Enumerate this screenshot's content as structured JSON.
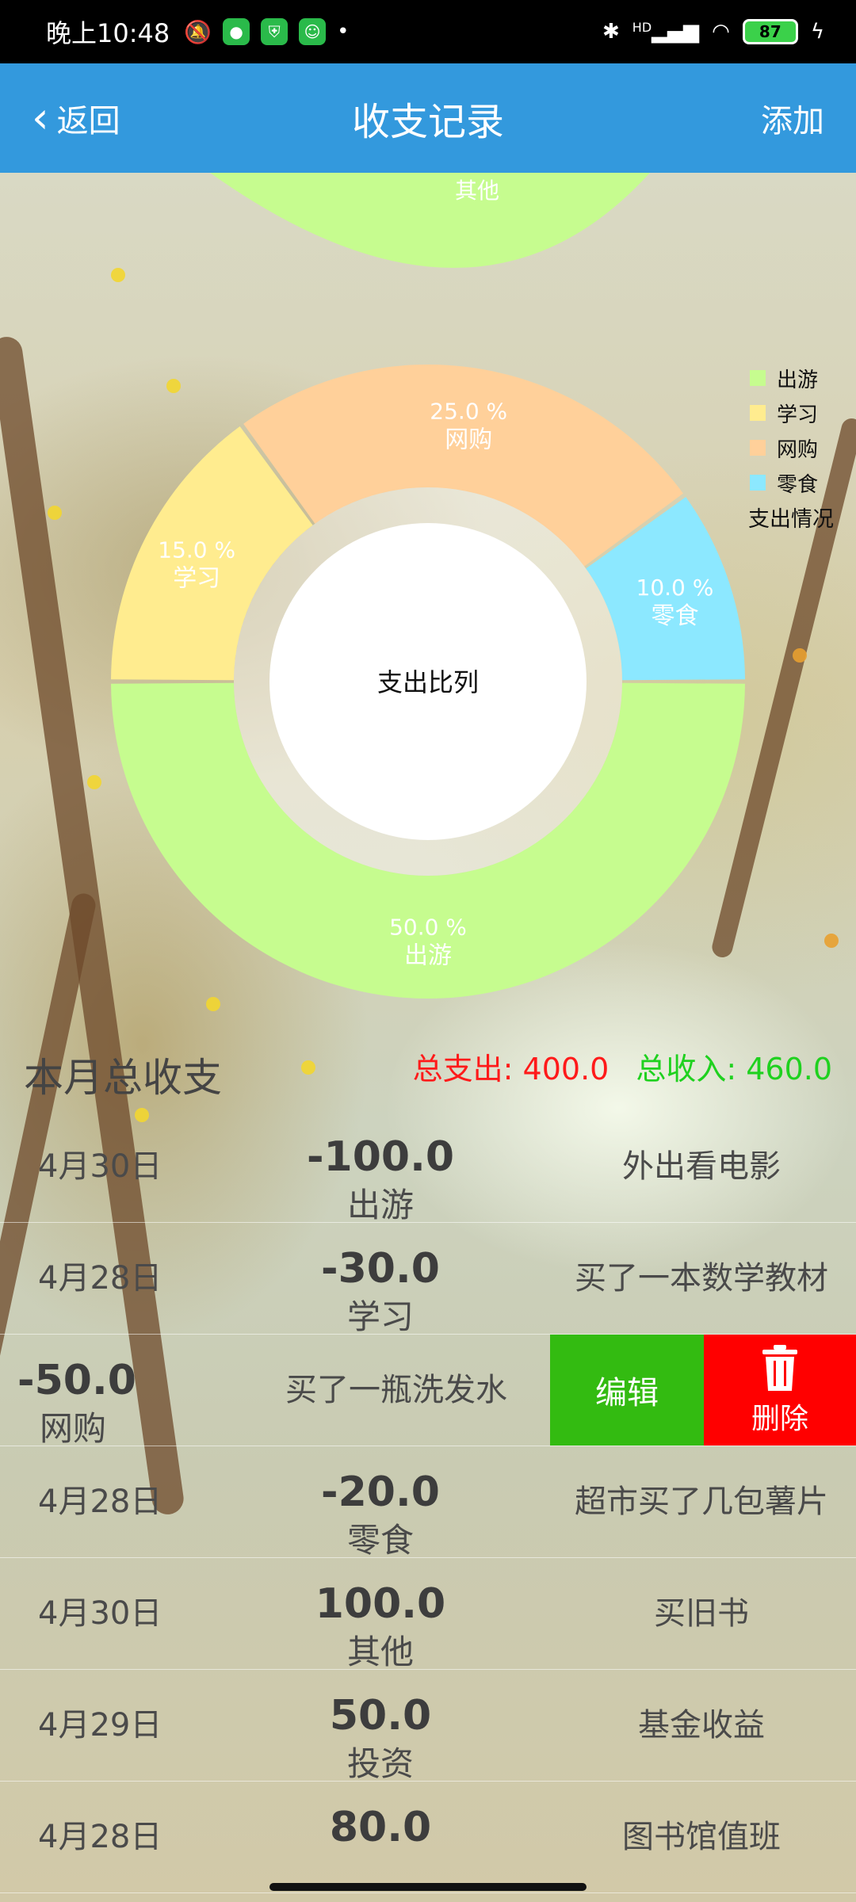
{
  "status_bar": {
    "time": "晚上10:48",
    "battery": "87",
    "network": "HD",
    "dot": "•"
  },
  "header": {
    "back_label": "返回",
    "back_icon": "chevron-left-icon",
    "title": "收支记录",
    "add_label": "添加"
  },
  "colors": {
    "header_bg": "#3399dd",
    "expense": "#ff1a1a",
    "income": "#1fd11f",
    "edit_button": "#33bb11",
    "delete_button": "#ff0000"
  },
  "chart_data": [
    {
      "type": "pie",
      "partial": true,
      "slices": [
        {
          "label": "其他",
          "color": "#c6fc8f"
        }
      ]
    },
    {
      "type": "pie",
      "style": "donut",
      "center_text": "支出比列",
      "legend_title": "支出情况",
      "legend_position": "right",
      "slices": [
        {
          "label": "出游",
          "value": 50.0,
          "value_label": "50.0 %",
          "color": "#c6fc8f"
        },
        {
          "label": "学习",
          "value": 15.0,
          "value_label": "15.0 %",
          "color": "#ffec8f"
        },
        {
          "label": "网购",
          "value": 25.0,
          "value_label": "25.0 %",
          "color": "#ffd09a"
        },
        {
          "label": "零食",
          "value": 10.0,
          "value_label": "10.0 %",
          "color": "#8ce8ff"
        }
      ]
    }
  ],
  "summary": {
    "title": "本月总收支",
    "expense_text": "总支出: 400.0",
    "income_text": "总收入: 460.0"
  },
  "swipe_actions": {
    "edit_label": "编辑",
    "delete_label": "删除"
  },
  "records": [
    {
      "date": "4月30日",
      "amount": "-100.0",
      "category": "出游",
      "note": "外出看电影"
    },
    {
      "date": "4月28日",
      "amount": "-30.0",
      "category": "学习",
      "note": "买了一本数学教材"
    },
    {
      "date": "",
      "amount": "-50.0",
      "category": "网购",
      "note": "买了一瓶洗发水",
      "swiped": true
    },
    {
      "date": "4月28日",
      "amount": "-20.0",
      "category": "零食",
      "note": "超市买了几包薯片"
    },
    {
      "date": "4月30日",
      "amount": "100.0",
      "category": "其他",
      "note": "买旧书"
    },
    {
      "date": "4月29日",
      "amount": "50.0",
      "category": "投资",
      "note": "基金收益"
    },
    {
      "date": "4月28日",
      "amount": "80.0",
      "category": "",
      "note": "图书馆值班"
    }
  ]
}
